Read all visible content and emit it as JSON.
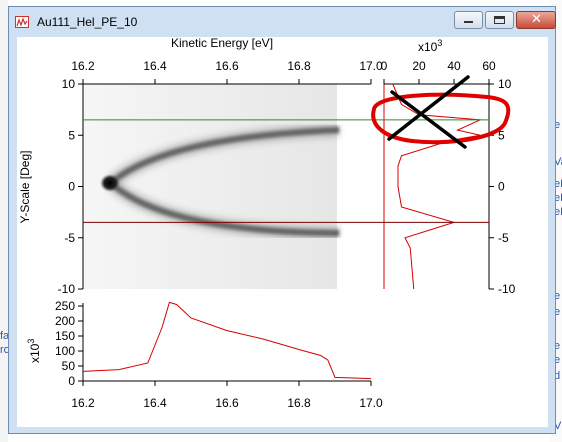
{
  "window": {
    "title": "Au111_Hel_PE_10",
    "minimize_icon": "minimize-icon",
    "maximize_icon": "maximize-icon",
    "close_icon": "close-icon"
  },
  "background_fragments": {
    "left": [
      "fa",
      "ro"
    ],
    "right": [
      "e",
      "Va",
      "eF",
      "eF",
      "eF",
      "e",
      "e",
      "e",
      "e",
      "d",
      "V"
    ]
  },
  "colors": {
    "trace": "#d40000",
    "cursor_top": "#2d8a2d",
    "cursor_bottom": "#7a0000",
    "annotation_circle": "#e00000",
    "annotation_cross": "#000000"
  },
  "main_plot": {
    "top_axis_title": "Kinetic Energy [eV]",
    "left_axis_title": "Y-Scale [Deg]",
    "x_ticks": [
      "16.2",
      "16.4",
      "16.6",
      "16.8",
      "17.0"
    ],
    "y_ticks": [
      "10",
      "5",
      "0",
      "-5",
      "-10"
    ]
  },
  "side_plot": {
    "multiplier": "x10",
    "multiplier_exp": "3",
    "x_ticks": [
      "0",
      "20",
      "40",
      "60"
    ],
    "y_ticks": [
      "10",
      "5",
      "0",
      "-5",
      "-10"
    ]
  },
  "bottom_plot": {
    "y_multiplier": "x10",
    "y_multiplier_exp": "3",
    "y_ticks": [
      "250",
      "200",
      "150",
      "100",
      "50",
      "0"
    ],
    "x_ticks": [
      "16.2",
      "16.4",
      "16.6",
      "16.8",
      "17.0"
    ]
  },
  "chart_data": {
    "type": "line",
    "edc_profile": {
      "x": [
        16.2,
        16.3,
        16.38,
        16.42,
        16.44,
        16.46,
        16.5,
        16.6,
        16.7,
        16.8,
        16.86,
        16.88,
        16.9,
        17.0
      ],
      "y": [
        32,
        38,
        60,
        180,
        262,
        255,
        210,
        168,
        140,
        105,
        85,
        70,
        12,
        8
      ],
      "ylim": [
        0,
        260
      ],
      "xlim": [
        16.2,
        17.0
      ]
    },
    "mdc_profile": {
      "y_deg": [
        10,
        8,
        7,
        6.5,
        5.5,
        5,
        4.5,
        3,
        2,
        0,
        -2,
        -3.5,
        -5,
        -6,
        -8,
        -10
      ],
      "intensity": [
        5,
        10,
        20,
        55,
        42,
        55,
        38,
        10,
        8,
        8,
        10,
        40,
        12,
        15,
        16,
        17
      ],
      "xlim": [
        0,
        60
      ],
      "ylim": [
        -10,
        10
      ]
    },
    "cursors_deg": [
      6.5,
      -3.5
    ]
  }
}
